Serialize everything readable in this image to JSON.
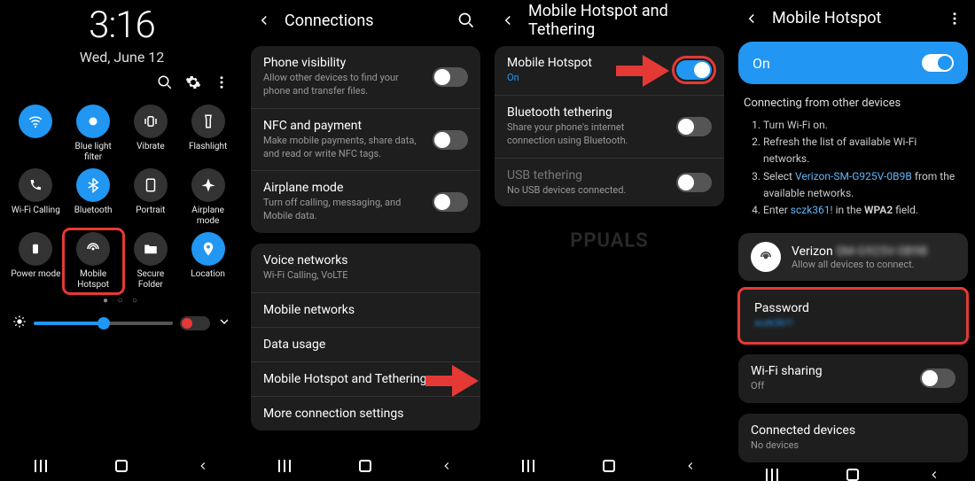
{
  "screen1": {
    "time": "3:16",
    "date": "Wed, June 12",
    "quickSettings": [
      {
        "label": "",
        "on": true,
        "icon": "wifi"
      },
      {
        "label": "Blue light filter",
        "on": true,
        "icon": "blue-light"
      },
      {
        "label": "Vibrate",
        "on": false,
        "icon": "vibrate"
      },
      {
        "label": "Flashlight",
        "on": false,
        "icon": "flashlight"
      },
      {
        "label": "Wi-Fi Calling",
        "on": false,
        "icon": "wifi-calling"
      },
      {
        "label": "Bluetooth",
        "on": true,
        "icon": "bluetooth"
      },
      {
        "label": "Portrait",
        "on": false,
        "icon": "rotate"
      },
      {
        "label": "Airplane mode",
        "on": false,
        "icon": "airplane"
      },
      {
        "label": "Power mode",
        "on": false,
        "icon": "power"
      },
      {
        "label": "Mobile Hotspot",
        "on": false,
        "icon": "hotspot",
        "highlight": true
      },
      {
        "label": "Secure Folder",
        "on": false,
        "icon": "folder"
      },
      {
        "label": "Location",
        "on": true,
        "icon": "location"
      }
    ]
  },
  "screen2": {
    "title": "Connections",
    "items": [
      {
        "title": "Phone visibility",
        "sub": "Allow other devices to find your phone and transfer files.",
        "toggle": true,
        "toggleOn": false
      },
      {
        "title": "NFC and payment",
        "sub": "Make mobile payments, share data, and read or write NFC tags.",
        "toggle": true,
        "toggleOn": false
      },
      {
        "title": "Airplane mode",
        "sub": "Turn off calling, messaging, and Mobile data.",
        "toggle": true,
        "toggleOn": false
      }
    ],
    "items2": [
      {
        "title": "Voice networks",
        "sub": "Wi-Fi Calling, VoLTE"
      },
      {
        "title": "Mobile networks"
      },
      {
        "title": "Data usage"
      },
      {
        "title": "Mobile Hotspot and Tethering",
        "highlight": true
      },
      {
        "title": "More connection settings"
      }
    ]
  },
  "screen3": {
    "title": "Mobile Hotspot and Tethering",
    "items": [
      {
        "title": "Mobile Hotspot",
        "sub": "On",
        "subBlue": true,
        "toggle": true,
        "toggleOn": true,
        "highlight": true
      },
      {
        "title": "Bluetooth tethering",
        "sub": "Share your phone's internet connection using Bluetooth.",
        "toggle": true,
        "toggleOn": false
      },
      {
        "title": "USB tethering",
        "sub": "No USB devices connected.",
        "toggle": true,
        "disabled": true,
        "toggleOn": false
      }
    ]
  },
  "screen4": {
    "title": "Mobile Hotspot",
    "onLabel": "On",
    "instructionsTitle": "Connecting from other devices",
    "steps": [
      "Turn Wi-Fi on.",
      "Refresh the list of available Wi-Fi networks.",
      "Select <a>Verizon-SM-G925V-0B9B</a> from the available networks.",
      "Enter <a>sczk361!</a> in the <b>WPA2</b> field."
    ],
    "netName": "Verizon",
    "netSub": "Allow all devices to connect.",
    "passwordLabel": "Password",
    "wifiSharing": {
      "title": "Wi-Fi sharing",
      "sub": "Off"
    },
    "connected": {
      "title": "Connected devices",
      "sub": "No devices"
    }
  },
  "watermark": "PPUALS"
}
